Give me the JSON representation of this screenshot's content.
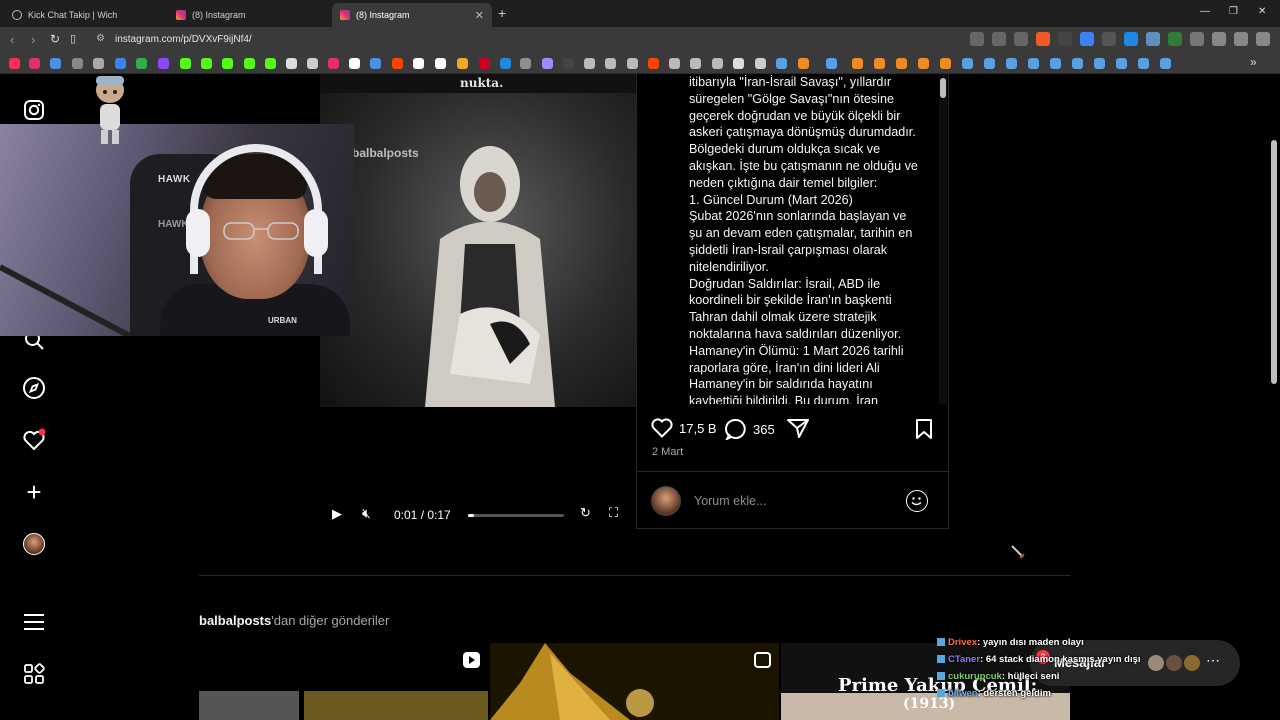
{
  "browser": {
    "tabs": [
      {
        "label": "Kick Chat Takip | Wich",
        "active": false
      },
      {
        "label": "(8) Instagram",
        "active": false
      },
      {
        "label": "(8) Instagram",
        "active": true
      }
    ],
    "url": "instagram.com/p/DVXvF9ijNf4/"
  },
  "media": {
    "overlay_text": "nukta.",
    "watermark": "balbalposts",
    "time": "0:01 / 0:17",
    "progress_fraction": 0.06
  },
  "post": {
    "caption_lines": [
      "itibarıyla \"İran-İsrail Savaşı\", yıllardır",
      "süregelen \"Gölge Savaşı\"nın ötesine",
      "geçerek doğrudan ve büyük ölçekli bir",
      "askeri çatışmaya dönüşmüş durumdadır.",
      "Bölgedeki durum oldukça sıcak ve",
      "akışkan. İşte bu çatışmanın ne olduğu ve",
      "neden çıktığına dair temel bilgiler:",
      "1. Güncel Durum (Mart 2026)",
      "Şubat 2026'nın sonlarında başlayan ve",
      "şu an devam eden çatışmalar, tarihin en",
      "şiddetli İran-İsrail çarpışması olarak",
      "nitelendiriliyor.",
      "Doğrudan Saldırılar: İsrail, ABD ile",
      "koordineli bir şekilde İran'ın başkenti",
      "Tahran dahil olmak üzere stratejik",
      "noktalarına hava saldırıları düzenliyor.",
      "Hamaney'in Ölümü: 1 Mart 2026 tarihli",
      "raporlara göre, İran'ın dini lideri Ali",
      "Hamaney'in bir saldırıda hayatını",
      "kaybettiği bildirildi. Bu durum, İran"
    ],
    "likes": "17,5 B",
    "comments": "365",
    "date": "2 Mart",
    "comment_placeholder": "Yorum ekle..."
  },
  "more_posts": {
    "username": "balbalposts",
    "suffix": "'dan diğer gönderiler",
    "thumb3_title": "Prime Yakup Cemil:",
    "thumb3_year": "(1913)"
  },
  "messages": {
    "label": "Mesajlar",
    "badge": "8"
  },
  "stream_chat": [
    {
      "user": "Drivex",
      "text": ": yayın dısı maden olayı"
    },
    {
      "user": "CTaner",
      "text": ": 64 stack diamon kasmış yayın dışı"
    },
    {
      "user": "cukurupcuk",
      "text": ": hülleci seni"
    },
    {
      "user": "bilwen",
      "text": ": dersten geldim"
    }
  ],
  "webcam": {
    "chair_brand": "HAWK",
    "shirt_text": "URBAN"
  },
  "colors": {
    "background": "#000000",
    "notification": "#ff3040",
    "secondary_text": "#a8a8a8"
  }
}
